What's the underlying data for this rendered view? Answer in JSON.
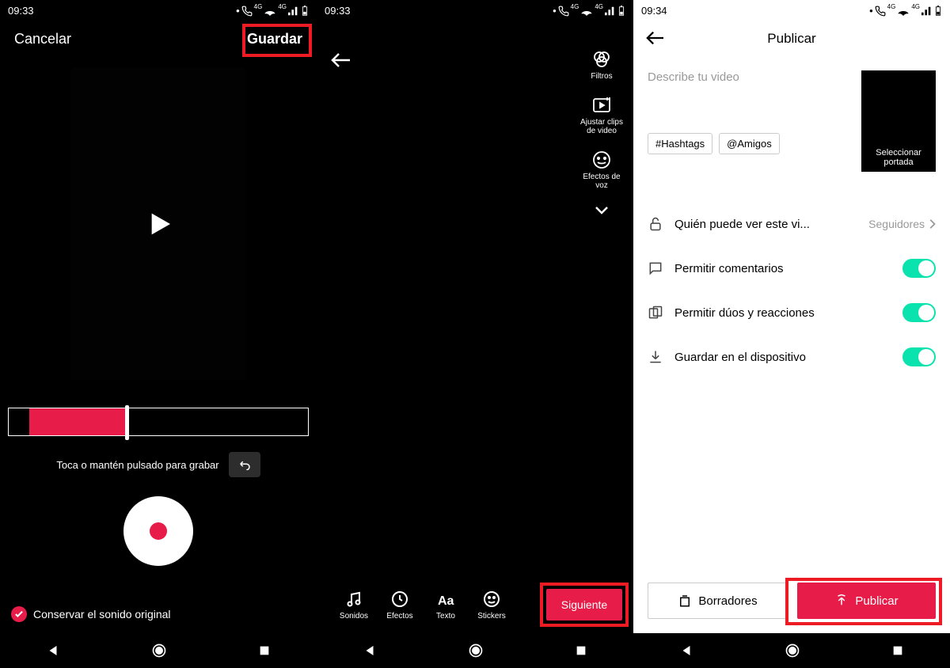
{
  "status": {
    "time1": "09:33",
    "time2": "09:33",
    "time3": "09:34",
    "net": "4G"
  },
  "screen1": {
    "cancel": "Cancelar",
    "save": "Guardar",
    "hint": "Toca o mantén pulsado para grabar",
    "keep_sound": "Conservar el sonido original"
  },
  "screen2": {
    "tools": {
      "filtros": "Filtros",
      "ajustar": "Ajustar clips de video",
      "voz": "Efectos de voz"
    },
    "bottom": {
      "sonidos": "Sonidos",
      "efectos": "Efectos",
      "texto": "Texto",
      "stickers": "Stickers",
      "next": "Siguiente"
    }
  },
  "screen3": {
    "title": "Publicar",
    "placeholder": "Describe tu video",
    "cover": "Seleccionar portada",
    "chip_hash": "#Hashtags",
    "chip_friends": "@Amigos",
    "opt_who": "Quién puede ver este vi...",
    "opt_who_val": "Seguidores",
    "opt_comments": "Permitir comentarios",
    "opt_duets": "Permitir dúos y reacciones",
    "opt_save": "Guardar en el dispositivo",
    "drafts": "Borradores",
    "publish": "Publicar"
  }
}
